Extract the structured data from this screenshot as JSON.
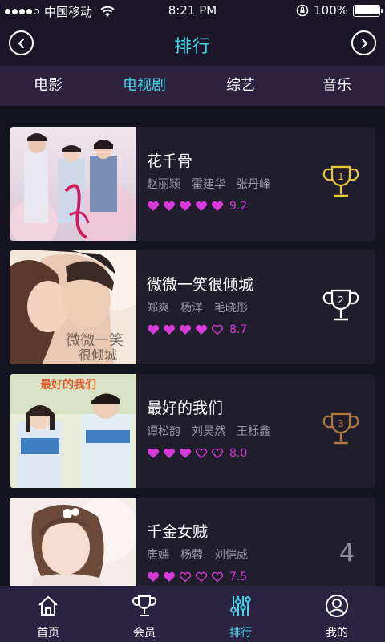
{
  "status": {
    "carrier": "中国移动",
    "time": "8:21 PM",
    "battery": "100%"
  },
  "header": {
    "title": "排行",
    "prev_icon": "chevron-left-icon",
    "next_icon": "chevron-right-icon"
  },
  "tabs": [
    {
      "label": "电影",
      "active": false
    },
    {
      "label": "电视剧",
      "active": true
    },
    {
      "label": "综艺",
      "active": false
    },
    {
      "label": "音乐",
      "active": false
    }
  ],
  "colors": {
    "accent": "#3fd7e8",
    "heart": "#d63ad9",
    "gold": "#e8c93a",
    "silver": "#ffffff",
    "bronze": "#b27a3a"
  },
  "items": [
    {
      "rank": "1",
      "title": "花千骨",
      "cast": [
        "赵丽颖",
        "霍建华",
        "张丹峰"
      ],
      "hearts": 5,
      "score": "9.2"
    },
    {
      "rank": "2",
      "title": "微微一笑很倾城",
      "cast": [
        "郑爽",
        "杨洋",
        "毛晓彤"
      ],
      "hearts": 4,
      "score": "8.7"
    },
    {
      "rank": "3",
      "title": "最好的我们",
      "cast": [
        "谭松韵",
        "刘昊然",
        "王栎鑫"
      ],
      "hearts": 3,
      "score": "8.0"
    },
    {
      "rank": "4",
      "title": "千金女贼",
      "cast": [
        "唐嫣",
        "杨蓉",
        "刘恺威"
      ],
      "hearts": 2,
      "score": "7.5"
    }
  ],
  "bottom_nav": [
    {
      "label": "首页",
      "icon": "home-icon",
      "active": false
    },
    {
      "label": "会员",
      "icon": "trophy-icon",
      "active": false
    },
    {
      "label": "排行",
      "icon": "sliders-icon",
      "active": true
    },
    {
      "label": "我的",
      "icon": "user-icon",
      "active": false
    }
  ]
}
